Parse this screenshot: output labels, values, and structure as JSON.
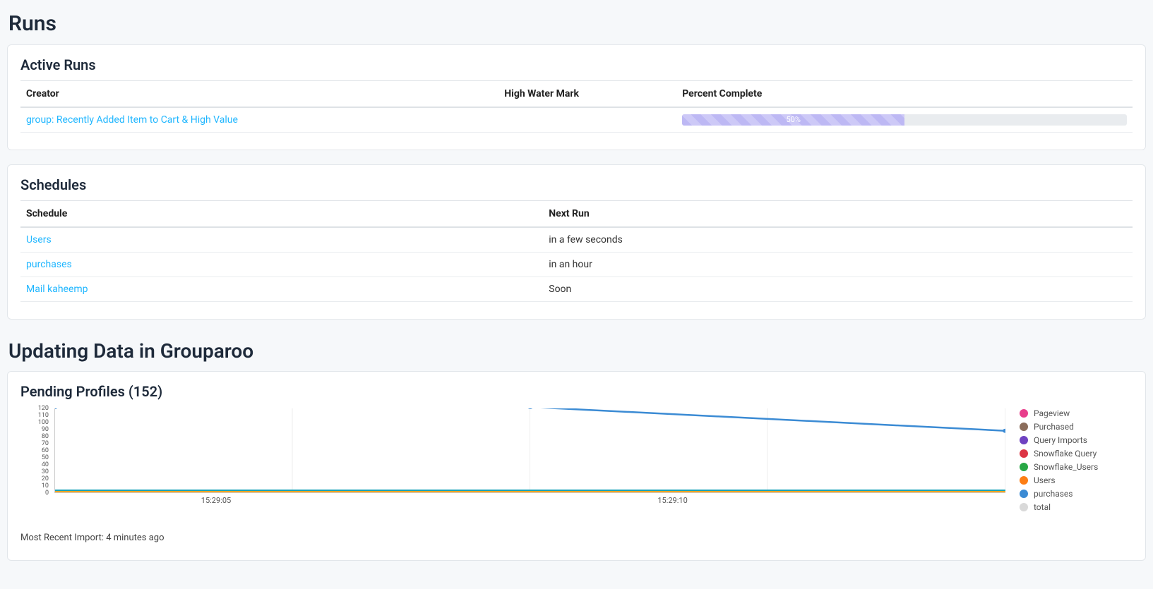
{
  "runs_heading": "Runs",
  "active_runs": {
    "title": "Active Runs",
    "columns": {
      "creator": "Creator",
      "hwm": "High Water Mark",
      "pct": "Percent Complete"
    },
    "rows": [
      {
        "creator": "group: Recently Added Item to Cart & High Value",
        "hwm": "",
        "pct_label": "50%",
        "pct_value": 50
      }
    ]
  },
  "schedules": {
    "title": "Schedules",
    "columns": {
      "schedule": "Schedule",
      "next_run": "Next Run"
    },
    "rows": [
      {
        "schedule": "Users",
        "next_run": "in a few seconds"
      },
      {
        "schedule": "purchases",
        "next_run": "in an hour"
      },
      {
        "schedule": "Mail kaheemp",
        "next_run": "Soon"
      }
    ]
  },
  "updating_heading": "Updating Data in Grouparoo",
  "pending": {
    "title": "Pending Profiles (152)",
    "footer": "Most Recent Import: 4 minutes ago"
  },
  "chart_data": {
    "type": "line",
    "title": "Pending Profiles (152)",
    "ylabel": "",
    "xlabel": "",
    "ylim": [
      0,
      120
    ],
    "y_ticks": [
      0,
      10,
      20,
      30,
      40,
      50,
      60,
      70,
      80,
      90,
      100,
      110,
      120
    ],
    "x_ticks": [
      "15:29:05",
      "15:29:10"
    ],
    "x": [
      0,
      1,
      2
    ],
    "series": [
      {
        "name": "Pageview",
        "color": "#e83e8c",
        "values": [
          0,
          0,
          0
        ]
      },
      {
        "name": "Purchased",
        "color": "#8b6d5c",
        "values": [
          0,
          0,
          0
        ]
      },
      {
        "name": "Query Imports",
        "color": "#6f42c1",
        "values": [
          0,
          0,
          0
        ]
      },
      {
        "name": "Snowflake Query",
        "color": "#dc3545",
        "values": [
          0,
          0,
          0
        ]
      },
      {
        "name": "Snowflake_Users",
        "color": "#28a745",
        "values": [
          0,
          0,
          0
        ]
      },
      {
        "name": "Users",
        "color": "#fd7e14",
        "values": [
          0,
          0,
          0
        ]
      },
      {
        "name": "purchases",
        "color": "#3b8bd4",
        "values": [
          122,
          122,
          88
        ]
      },
      {
        "name": "total",
        "color": "#d9d9d9",
        "values": [
          0,
          0,
          0
        ]
      }
    ]
  }
}
